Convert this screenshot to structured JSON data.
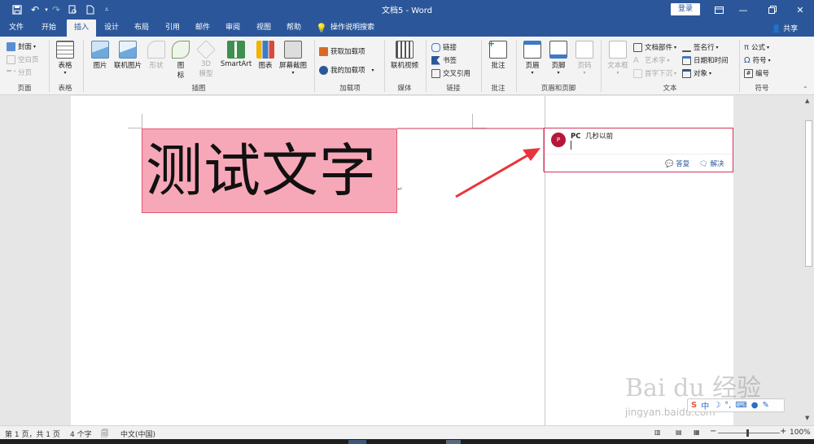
{
  "window": {
    "title": "文档5 - Word",
    "login_label": "登录"
  },
  "tabs": [
    {
      "label": "文件",
      "active": false
    },
    {
      "label": "开始",
      "active": false
    },
    {
      "label": "插入",
      "active": true
    },
    {
      "label": "设计",
      "active": false
    },
    {
      "label": "布局",
      "active": false
    },
    {
      "label": "引用",
      "active": false
    },
    {
      "label": "邮件",
      "active": false
    },
    {
      "label": "审阅",
      "active": false
    },
    {
      "label": "视图",
      "active": false
    },
    {
      "label": "帮助",
      "active": false
    }
  ],
  "tell_me": "操作说明搜索",
  "share_label": "共享",
  "ribbon": {
    "pages": {
      "label": "页面",
      "cover": "封面",
      "blank": "空白页",
      "page_break": "分页"
    },
    "tables": {
      "label": "表格",
      "table": "表格"
    },
    "illustrations": {
      "label": "插图",
      "picture": "图片",
      "online_picture": "联机图片",
      "shapes": "形状",
      "icons_1": "图",
      "icons_2": "标",
      "model_1": "3D",
      "model_2": "模型",
      "smartart": "SmartArt",
      "chart": "图表",
      "screenshot": "屏幕截图"
    },
    "addins": {
      "label": "加载项",
      "get": "获取加载项",
      "mine": "我的加载项"
    },
    "media": {
      "label": "媒体",
      "online_video": "联机视频"
    },
    "links": {
      "label": "链接",
      "link": "链接",
      "bookmark": "书签",
      "cross_ref": "交叉引用"
    },
    "comments": {
      "label": "批注",
      "comment": "批注"
    },
    "header_footer": {
      "label": "页眉和页脚",
      "header": "页眉",
      "footer": "页脚",
      "page_number": "页码"
    },
    "text": {
      "label": "文本",
      "textbox": "文本框",
      "quick_parts": "文档部件",
      "wordart": "艺术字",
      "drop_cap": "首字下沉",
      "signature": "签名行",
      "datetime": "日期和时间",
      "object": "对象"
    },
    "symbols": {
      "label": "符号",
      "equation": "公式",
      "symbol": "符号",
      "number": "编号"
    }
  },
  "document": {
    "heading_text": "测试文字"
  },
  "comment": {
    "avatar_letter": "P",
    "author": "PC",
    "time": "几秒以前",
    "reply_label": "答复",
    "resolve_label": "解决"
  },
  "statusbar": {
    "page_info": "第 1 页，共 1 页",
    "word_count": "4 个字",
    "language": "中文(中国)",
    "zoom": "100%"
  },
  "watermark": {
    "brand": "Bai du 经验",
    "url": "jingyan.baidu.com"
  },
  "colors": {
    "accent": "#2b579a",
    "highlight": "#f7a8b8",
    "comment_border": "#d1345b",
    "arrow": "#e8343c"
  }
}
